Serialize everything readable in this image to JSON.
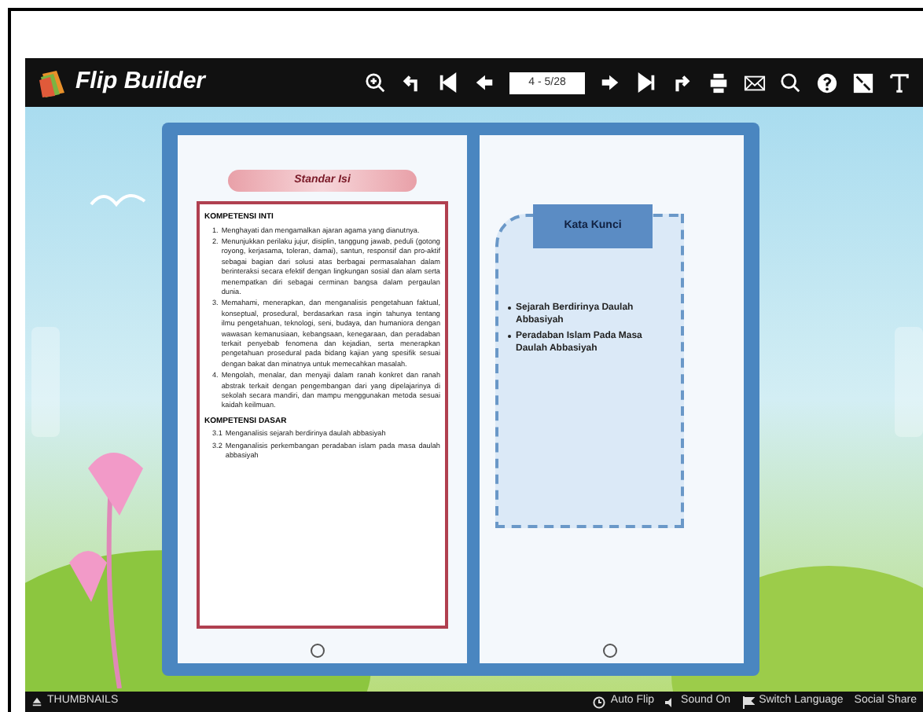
{
  "toolbar": {
    "logo": "Flip Builder",
    "page_field": "4 - 5/28"
  },
  "left_page": {
    "title": "Standar Isi",
    "sections": [
      {
        "heading": "KOMPETENSI INTI",
        "kind": "numbered",
        "items": [
          {
            "num": "1.",
            "text": "Menghayati dan mengamalkan ajaran agama yang dianutnya."
          },
          {
            "num": "2.",
            "text": "Menunjukkan perilaku jujur, disiplin, tanggung jawab, peduli (gotong royong, kerjasama, toleran, damai), santun, responsif dan pro-aktif sebagai bagian dari solusi atas berbagai permasalahan dalam berinteraksi secara efektif dengan lingkungan sosial dan alam serta menempatkan diri sebagai cerminan bangsa dalam pergaulan dunia."
          },
          {
            "num": "3.",
            "text": "Memahami, menerapkan, dan menganalisis pengetahuan faktual, konseptual, prosedural, berdasarkan rasa ingin tahunya tentang ilmu pengetahuan, teknologi, seni, budaya, dan humaniora dengan wawasan kemanusiaan, kebangsaan, kenegaraan, dan peradaban terkait penyebab fenomena dan kejadian, serta menerapkan pengetahuan prosedural pada bidang kajian yang spesifik sesuai dengan bakat dan minatnya untuk memecahkan masalah."
          },
          {
            "num": "4.",
            "text": "Mengolah, menalar, dan menyaji dalam ranah konkret dan ranah abstrak terkait dengan pengembangan dari yang dipelajarinya di sekolah secara mandiri, dan mampu menggunakan metoda sesuai kaidah keilmuan."
          }
        ]
      },
      {
        "heading": "KOMPETENSI DASAR",
        "kind": "numbered",
        "items": [
          {
            "num": "3.1",
            "text": "Menganalisis sejarah berdirinya daulah abbasiyah"
          },
          {
            "num": "3.2",
            "text": "Menganalisis perkembangan peradaban islam pada masa daulah abbasiyah"
          }
        ]
      }
    ]
  },
  "right_page": {
    "title": "Kata Kunci",
    "bullets": [
      "Sejarah Berdirinya Daulah Abbasiyah",
      "Peradaban Islam Pada Masa Daulah Abbasiyah"
    ]
  },
  "bottom_bar": {
    "thumbnails": "THUMBNAILS",
    "auto_flip": "Auto Flip",
    "sound": "Sound On",
    "language": "Switch Language",
    "social": "Social Share"
  }
}
